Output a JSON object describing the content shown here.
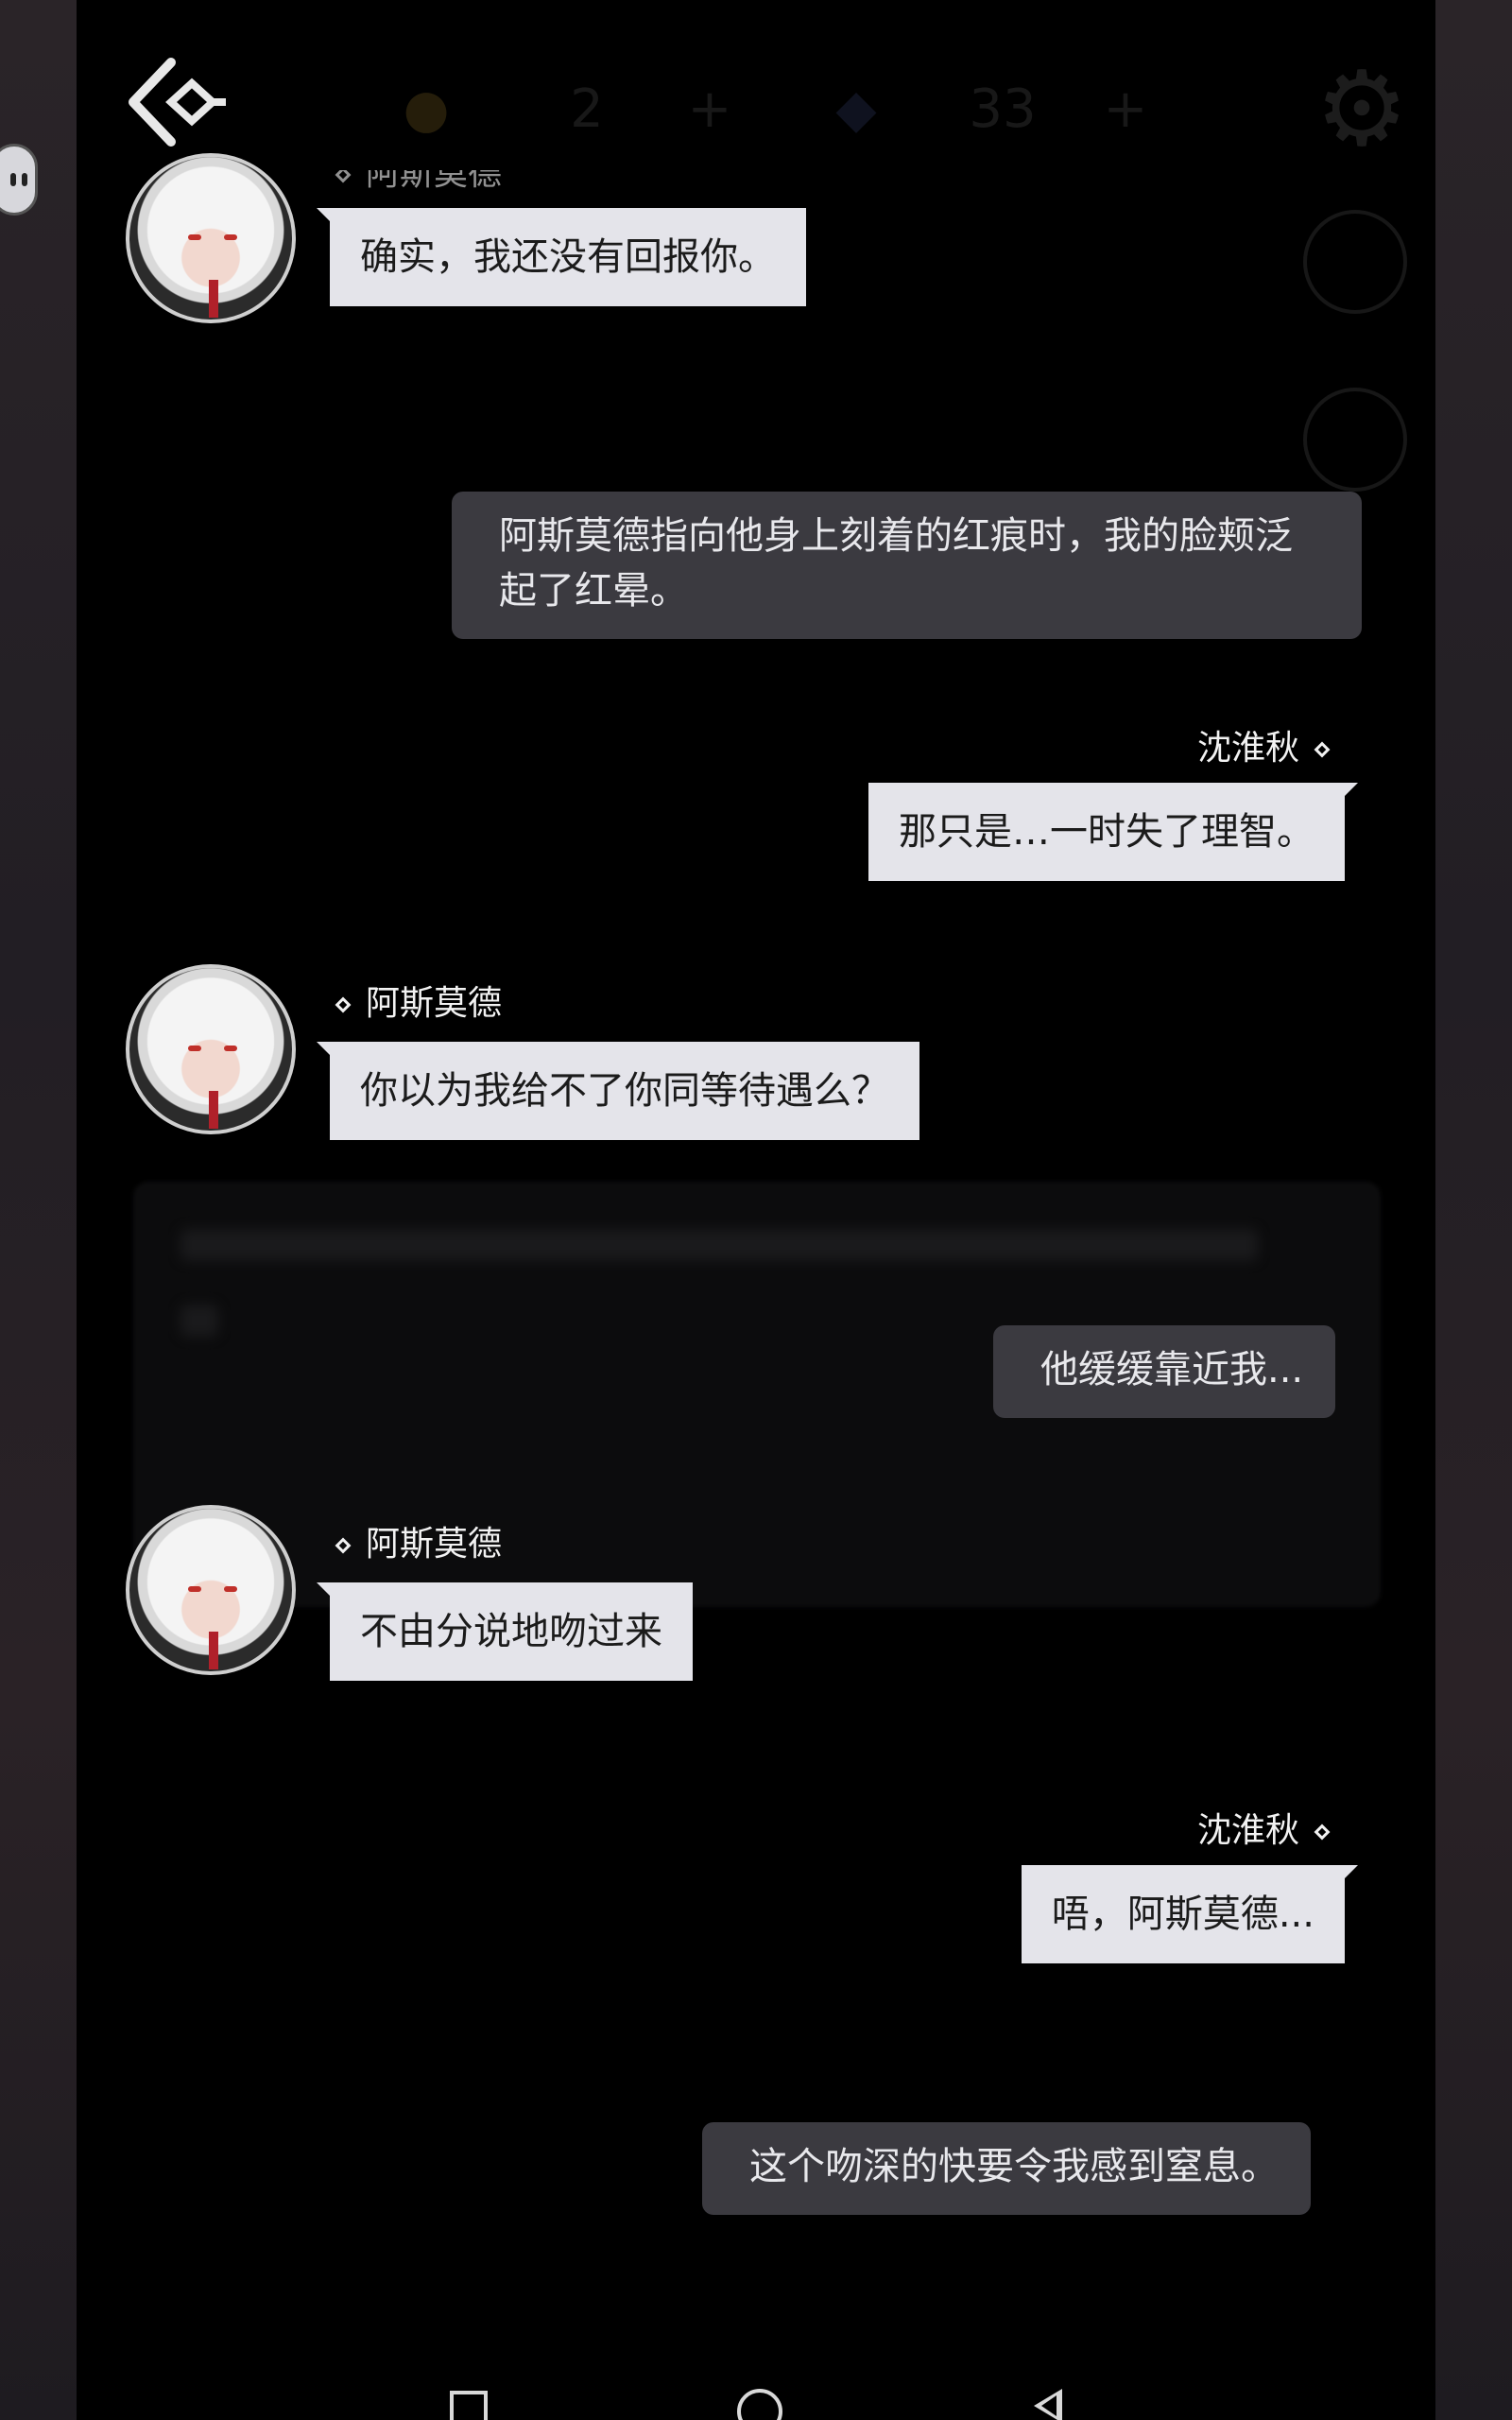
{
  "toolbar": {
    "num_1": "2",
    "plus_1": "+",
    "num_2": "33",
    "plus_2": "+"
  },
  "messages": [
    {
      "speaker": "阿斯莫德",
      "text": "确实，我还没有回报你。"
    },
    {
      "narration": "阿斯莫德指向他身上刻着的红痕时，我的脸颊泛起了红晕。"
    },
    {
      "speaker": "沈淮秋",
      "text": "那只是…一时失了理智。"
    },
    {
      "speaker": "阿斯莫德",
      "text": "你以为我给不了你同等待遇么？"
    },
    {
      "narration": "他缓缓靠近我..."
    },
    {
      "speaker": "阿斯莫德",
      "text": "不由分说地吻过来"
    },
    {
      "speaker": "沈淮秋",
      "text": "唔，阿斯莫德..."
    },
    {
      "narration": "这个吻深的快要令我感到窒息。"
    }
  ]
}
